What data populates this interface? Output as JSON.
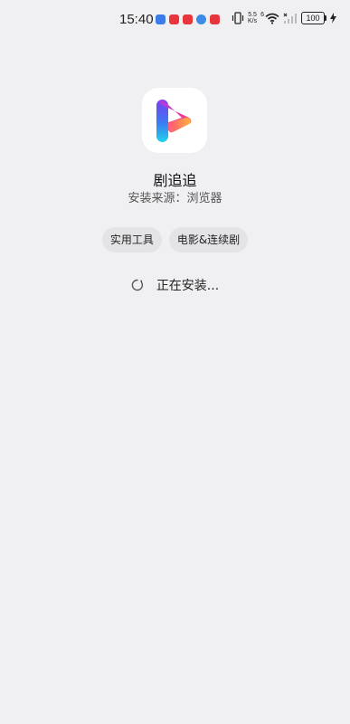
{
  "status_bar": {
    "time": "15:40",
    "net_speed_value": "5.5",
    "net_speed_unit": "K/s",
    "signal_generation": "6",
    "battery_level": "100",
    "icons": [
      "vibrate-icon",
      "wifi-icon",
      "signal-icon",
      "charging-icon"
    ]
  },
  "app": {
    "name": "剧追追",
    "install_source": "安装来源：浏览器"
  },
  "tags": [
    "实用工具",
    "电影&连续剧"
  ],
  "progress": {
    "status_text": "正在安装..."
  }
}
